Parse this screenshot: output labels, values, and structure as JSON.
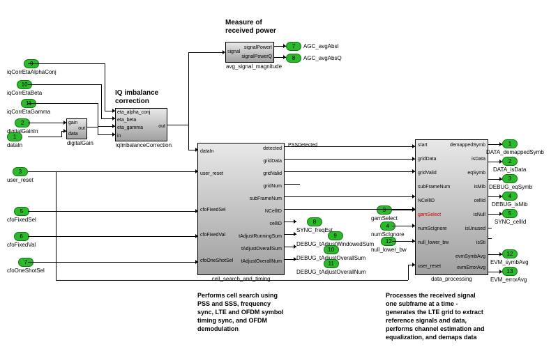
{
  "domain": "Diagram",
  "headers": {
    "iq": "IQ imbalance\ncorrection",
    "power": "Measure of\nreceived power"
  },
  "descriptions": {
    "cell": "Performs cell search using\nPSS and SSS, frequency\nsync, LTE and OFDM symbol\ntiming sync, and OFDM\ndemodulation",
    "data": "Processes the received signal\none subframe at a time -\ngenerates the LTE grid to extract\nreference signals and data,\nperforms channel estimation and\nequalization, and demaps data"
  },
  "inports": [
    {
      "n": "9",
      "lbl": "iqCorrEtaAlphaConj"
    },
    {
      "n": "10",
      "lbl": "iqCorrEtaBeta"
    },
    {
      "n": "11",
      "lbl": "iqCorrEtaGamma"
    },
    {
      "n": "2",
      "lbl": "digitalGainIn"
    },
    {
      "n": "1",
      "lbl": "dataIn"
    },
    {
      "n": "3",
      "lbl": "user_reset"
    },
    {
      "n": "5",
      "lbl": "cfoFixedSel"
    },
    {
      "n": "6",
      "lbl": "cfoFixedVal"
    },
    {
      "n": "7",
      "lbl": "cfoOneShotSel"
    }
  ],
  "agc_out": [
    {
      "n": "7",
      "lbl": "AGC_avgAbsI"
    },
    {
      "n": "8",
      "lbl": "AGC_avgAbsQ"
    }
  ],
  "sync_out": [
    {
      "n": "8",
      "lbl": "SYNC_freqEst"
    },
    {
      "n": "9",
      "lbl": "DEBUG_tAdjustWindowedSum"
    },
    {
      "n": "10",
      "lbl": "DEBUG_tAdjustOverallSum"
    },
    {
      "n": "11",
      "lbl": "DEBUG_tAdjustOverallNum"
    }
  ],
  "data_in": [
    {
      "n": "3",
      "lbl": "gamSelect"
    },
    {
      "n": "4",
      "lbl": "numScIgnore"
    },
    {
      "n": "12",
      "lbl": "null_lower_bw"
    }
  ],
  "data_out": [
    {
      "n": "1",
      "lbl": "DATA_demappedSymb"
    },
    {
      "n": "2",
      "lbl": "DATA_isData"
    },
    {
      "n": "3",
      "lbl": "DEBUG_eqSymb"
    },
    {
      "n": "4",
      "lbl": "DEBUG_isMib"
    },
    {
      "n": "5",
      "lbl": "SYNC_cellId"
    },
    {
      "n": "12",
      "lbl": "EVM_symbAvg"
    },
    {
      "n": "13",
      "lbl": "EVM_errorAvg"
    }
  ],
  "blocks": {
    "dgain": {
      "name": "digitalGain",
      "ports": {
        "in": [
          "gain",
          "data"
        ],
        "out": [
          "out"
        ]
      }
    },
    "iq": {
      "name": "iqImbalanceCorrection",
      "ports": {
        "in": [
          "eta_alpha_conj",
          "eta_beta",
          "eta_gamma",
          "in"
        ],
        "out": [
          "out"
        ]
      }
    },
    "avg": {
      "name": "avg_signal_magnitude",
      "ports": {
        "in": [
          "signal"
        ],
        "out": [
          "signalPowerI",
          "signalPowerQ"
        ]
      }
    },
    "cell": {
      "name": "cell_search_and_timing",
      "ports": {
        "in": [
          "dataIn",
          "user_reset",
          "cfoFixedSel",
          "cfoFixedVal",
          "cfoOneShotSel"
        ],
        "out": [
          "detected",
          "gridData",
          "gridValid",
          "gridNum",
          "subFrameNum",
          "NCellID",
          "cellID",
          "tAdjustRunningSum",
          "tAdjustOverallSum",
          "tAdjustOverallNum"
        ],
        "olbl": "PSSDetected"
      }
    },
    "dp": {
      "name": "data_processing",
      "ports": {
        "in": [
          "start",
          "gridData",
          "gridValid",
          "subFrameNum",
          "NCellID",
          "gamSelect",
          "numScIgnore",
          "null_lower_bw",
          "user_reset"
        ],
        "out": [
          "demappedSymb",
          "isData",
          "eqSymb",
          "isMib",
          "cellId",
          "isNull",
          "isUnused",
          "isSti",
          "evmSymbAvg",
          "evmErrorAvg"
        ]
      }
    }
  }
}
